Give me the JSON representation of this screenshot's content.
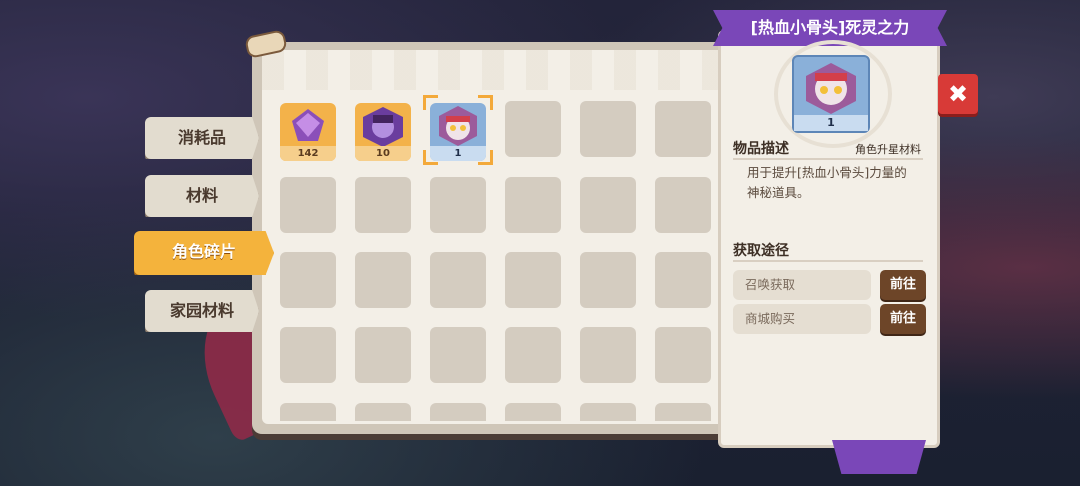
{
  "tabs": [
    {
      "label": "消耗品"
    },
    {
      "label": "材料"
    },
    {
      "label": "角色碎片"
    },
    {
      "label": "家园材料"
    }
  ],
  "inventory": [
    {
      "name": "purple-crystal",
      "qty": "142"
    },
    {
      "name": "purple-hero-shard",
      "qty": "10"
    },
    {
      "name": "skull-hero-shard",
      "qty": "1",
      "selected": true
    }
  ],
  "detail": {
    "title": "[热血小骨头]死灵之力",
    "preview_qty": "1",
    "desc_header": "物品描述",
    "tag": "角色升星材料",
    "description": "用于提升[热血小骨头]力量的神秘道具。",
    "source_header": "获取途径",
    "sources": [
      {
        "label": "召唤获取",
        "button": "前往"
      },
      {
        "label": "商城购买",
        "button": "前往"
      }
    ],
    "close": "✖"
  },
  "colors": {
    "accent": "#f4b33c",
    "ribbon": "#7a47b8",
    "close": "#d83a37"
  }
}
